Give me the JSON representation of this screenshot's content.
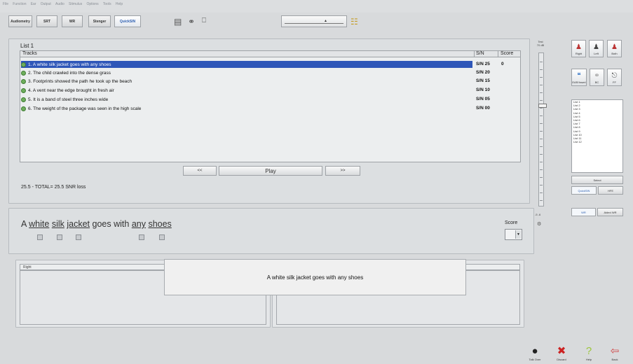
{
  "menu": [
    "File",
    "Function",
    "Ear",
    "Output",
    "Audio",
    "Stimulus",
    "Options",
    "Tools",
    "Help"
  ],
  "toolbar": {
    "buttons": [
      "Audiometry",
      "SRT",
      "WR",
      "Stenger",
      "QuickSIN"
    ],
    "active": "QuickSIN"
  },
  "list": {
    "title": "List 1",
    "col_tracks": "Tracks",
    "col_sn": "S/N",
    "col_score": "Score",
    "rows": [
      {
        "text": "1. A white silk jacket goes with any shoes",
        "sn": "S/N 25",
        "score": "0"
      },
      {
        "text": "2. The child crawled into the dense grass",
        "sn": "S/N 20",
        "score": ""
      },
      {
        "text": "3. Footprints showed the path he took up the beach",
        "sn": "S/N 15",
        "score": ""
      },
      {
        "text": "4. A vent near the edge brought in fresh air",
        "sn": "S/N 10",
        "score": ""
      },
      {
        "text": "5. It is a band of steel three inches wide",
        "sn": "S/N 05",
        "score": ""
      },
      {
        "text": "6. The weight of the package was seen in the high scale",
        "sn": "S/N 00",
        "score": ""
      }
    ],
    "prev_label": "<<",
    "play_label": "Play",
    "next_label": ">>",
    "snr_loss": "25.5 - TOTAL= 25.5 SNR loss"
  },
  "sentence": {
    "words": [
      {
        "w": "A",
        "key": false
      },
      {
        "w": "white",
        "key": true
      },
      {
        "w": "silk",
        "key": true
      },
      {
        "w": "jacket",
        "key": true
      },
      {
        "w": "goes",
        "key": false
      },
      {
        "w": "with",
        "key": false
      },
      {
        "w": "any",
        "key": true
      },
      {
        "w": "shoes",
        "key": true
      }
    ],
    "score_label": "Score"
  },
  "bottom": {
    "right_label": "Right",
    "popup_text": "A white silk jacket goes with any shoes"
  },
  "side": {
    "level_label_top": "Test",
    "level_label_sub": "70 dB",
    "level_bottom": "-5 -6",
    "ear_buttons": [
      "Right",
      "Left",
      "Both"
    ],
    "transducer_buttons": [
      "EAR/Insert",
      "BC",
      "FF"
    ],
    "lists": [
      "List 1",
      "List 2",
      "List 3",
      "List 4",
      "List 5",
      "List 6",
      "List 7",
      "List 8",
      "List 9",
      "List 10",
      "List 11",
      "List 12"
    ],
    "select_label": "Select",
    "mode_buttons": [
      "QuickSIN",
      "HFE"
    ],
    "wr_buttons": [
      "WR",
      "Aided WR"
    ]
  },
  "footer": {
    "icons": [
      {
        "label": "Talk Over",
        "icon": "microphone-icon"
      },
      {
        "label": "Discard",
        "icon": "x-icon"
      },
      {
        "label": "Help",
        "icon": "question-icon"
      },
      {
        "label": "Back",
        "icon": "back-arrow-icon"
      }
    ]
  },
  "colors": {
    "selection": "#2e56b8",
    "track_dot": "#6fae5c",
    "discard": "#cc2222",
    "help": "#9cc63c",
    "back": "#d04848"
  }
}
